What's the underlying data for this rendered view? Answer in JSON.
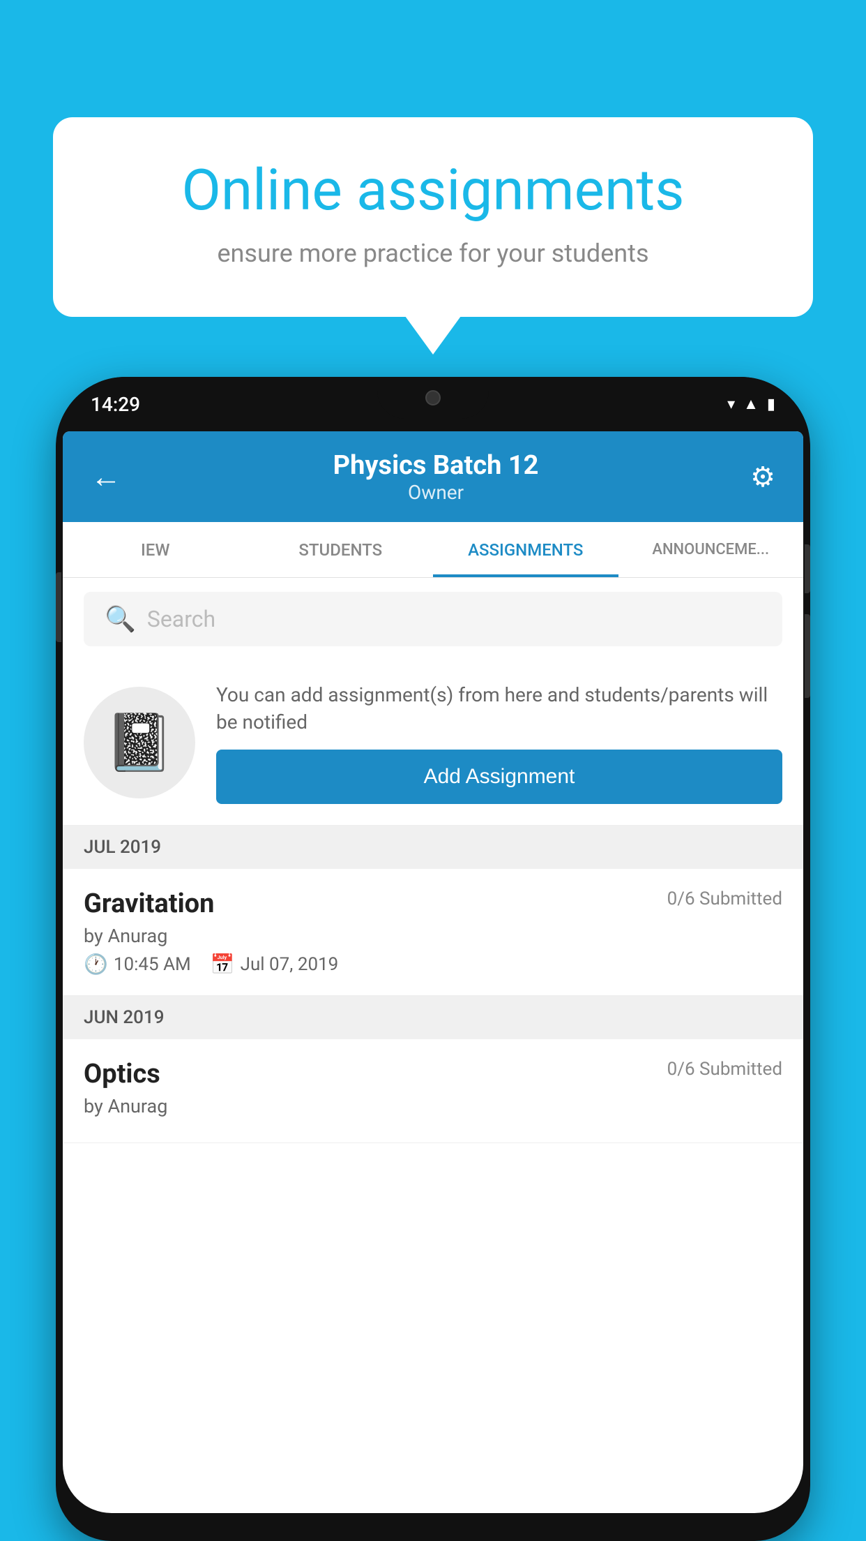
{
  "background_color": "#1ab8e8",
  "speech_bubble": {
    "title": "Online assignments",
    "subtitle": "ensure more practice for your students"
  },
  "phone": {
    "time": "14:29",
    "header": {
      "title": "Physics Batch 12",
      "subtitle": "Owner",
      "back_label": "←",
      "gear_label": "⚙"
    },
    "tabs": [
      {
        "label": "IEW",
        "active": false
      },
      {
        "label": "STUDENTS",
        "active": false
      },
      {
        "label": "ASSIGNMENTS",
        "active": true
      },
      {
        "label": "ANNOUNCEMENTS",
        "active": false
      }
    ],
    "search": {
      "placeholder": "Search"
    },
    "promo": {
      "text": "You can add assignment(s) from here and students/parents will be notified",
      "button_label": "Add Assignment"
    },
    "sections": [
      {
        "month_label": "JUL 2019",
        "assignments": [
          {
            "name": "Gravitation",
            "submitted": "0/6 Submitted",
            "by": "by Anurag",
            "time": "10:45 AM",
            "date": "Jul 07, 2019"
          }
        ]
      },
      {
        "month_label": "JUN 2019",
        "assignments": [
          {
            "name": "Optics",
            "submitted": "0/6 Submitted",
            "by": "by Anurag",
            "time": "",
            "date": ""
          }
        ]
      }
    ]
  }
}
